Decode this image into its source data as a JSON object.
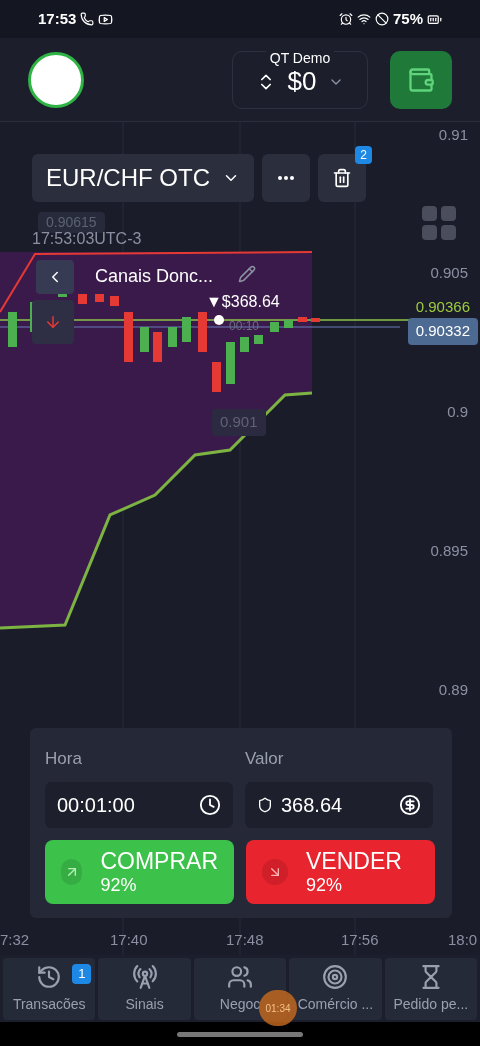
{
  "status_bar": {
    "time": "17:53",
    "battery": "75%"
  },
  "header": {
    "account_label": "QT Demo",
    "balance": "$0"
  },
  "toolbar": {
    "asset": "EUR/CHF OTC",
    "delete_badge": "2"
  },
  "chart": {
    "y_labels": [
      "0.91",
      "0.905",
      "0.9",
      "0.895",
      "0.89"
    ],
    "x_labels": [
      "7:32",
      "17:40",
      "17:48",
      "17:56",
      "18:0"
    ],
    "high_tag": "0.90615",
    "clock": "17:53:03UTC-3",
    "indicator": "Canais Donc...",
    "amount_marker": "▼$368.64",
    "countdown": "00:10",
    "channel_price": "0.90366",
    "current_price": "0.90332",
    "low_tag": "0.901"
  },
  "trade": {
    "time_label": "Hora",
    "time_value": "00:01:00",
    "amount_label": "Valor",
    "amount_value": "368.64",
    "buttons": [
      {
        "kind": "buy",
        "label": "COMPRAR",
        "payout": "92%"
      },
      {
        "kind": "sell",
        "label": "VENDER",
        "payout": "92%"
      }
    ]
  },
  "nav": [
    {
      "kind": "history",
      "label": "Transacões",
      "badge": "1"
    },
    {
      "kind": "signals",
      "label": "Sinais"
    },
    {
      "kind": "people",
      "label": "Negoc"
    },
    {
      "kind": "target",
      "label": "Comércio ..."
    },
    {
      "kind": "hourglass",
      "label": "Pedido pe..."
    }
  ],
  "recording_badge": "01:34"
}
